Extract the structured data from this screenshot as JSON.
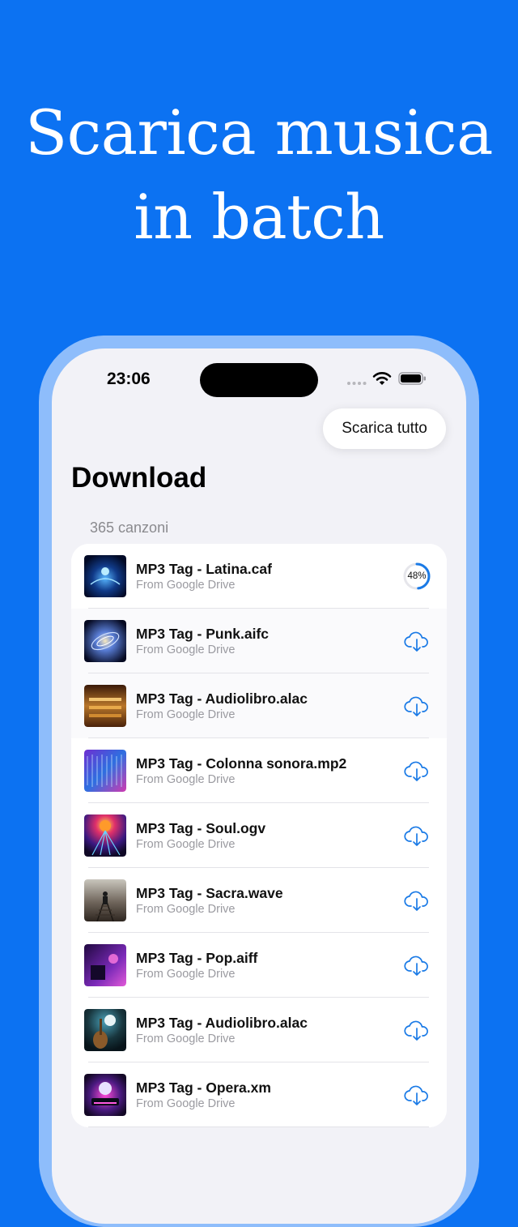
{
  "headline": {
    "line1": "Scarica musica",
    "line2": "in batch"
  },
  "status_bar": {
    "time": "23:06"
  },
  "toolbar": {
    "download_all_label": "Scarica tutto"
  },
  "page": {
    "title": "Download",
    "count_label": "365 canzoni"
  },
  "colors": {
    "background": "#0c72f2",
    "accent": "#1a7ae6"
  },
  "songs": [
    {
      "title": "MP3 Tag - Latina.caf",
      "source": "From Google Drive",
      "status": "downloading",
      "progress_label": "48%",
      "progress": 0.48
    },
    {
      "title": "MP3 Tag - Punk.aifc",
      "source": "From Google Drive",
      "status": "download-icon"
    },
    {
      "title": "MP3 Tag - Audiolibro.alac",
      "source": "From Google Drive",
      "status": "download-icon"
    },
    {
      "title": "MP3 Tag - Colonna sonora.mp2",
      "source": "From Google Drive",
      "status": "download-icon"
    },
    {
      "title": "MP3 Tag - Soul.ogv",
      "source": "From Google Drive",
      "status": "download-icon"
    },
    {
      "title": "MP3 Tag - Sacra.wave",
      "source": "From Google Drive",
      "status": "download-icon"
    },
    {
      "title": "MP3 Tag - Pop.aiff",
      "source": "From Google Drive",
      "status": "download-icon"
    },
    {
      "title": "MP3 Tag - Audiolibro.alac",
      "source": "From Google Drive",
      "status": "download-icon"
    },
    {
      "title": "MP3 Tag - Opera.xm",
      "source": "From Google Drive",
      "status": "download-icon"
    }
  ]
}
